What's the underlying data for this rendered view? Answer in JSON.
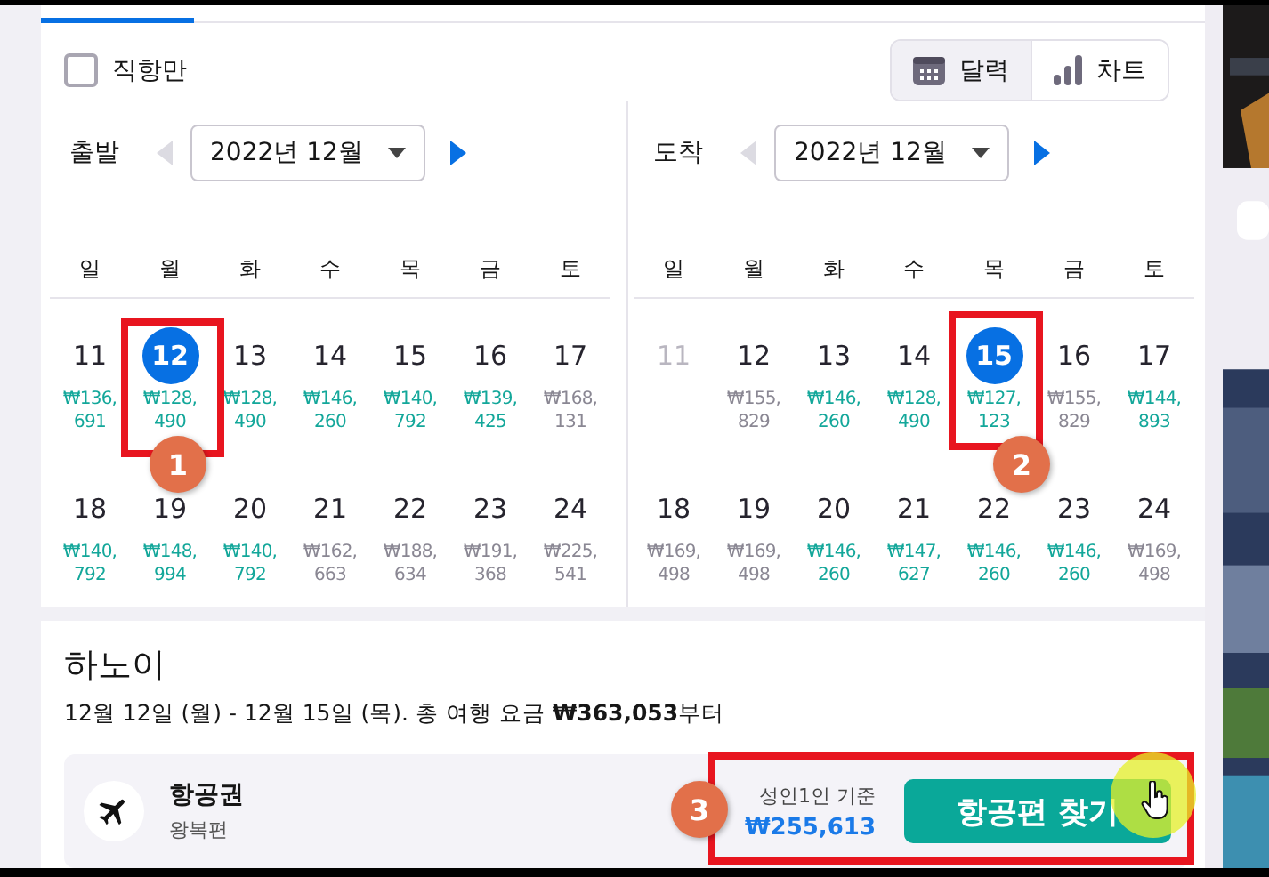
{
  "direct_only": {
    "label": "직항만",
    "checked": false
  },
  "view_toggle": [
    {
      "kind": "calendar",
      "label": "달력",
      "selected": true
    },
    {
      "kind": "chart",
      "label": "차트",
      "selected": false
    }
  ],
  "calendars": [
    {
      "label": "출발",
      "month": "2022년 12월",
      "prev_disabled": true,
      "weekdays": [
        "일",
        "월",
        "화",
        "수",
        "목",
        "금",
        "토"
      ],
      "weeks": [
        [
          {
            "day": "11",
            "price": "₩136,691",
            "cheap": true,
            "selected": false,
            "disabled": false
          },
          {
            "day": "12",
            "price": "₩128,490",
            "cheap": true,
            "selected": true,
            "disabled": false
          },
          {
            "day": "13",
            "price": "₩128,490",
            "cheap": true,
            "selected": false,
            "disabled": false
          },
          {
            "day": "14",
            "price": "₩146,260",
            "cheap": true,
            "selected": false,
            "disabled": false
          },
          {
            "day": "15",
            "price": "₩140,792",
            "cheap": true,
            "selected": false,
            "disabled": false
          },
          {
            "day": "16",
            "price": "₩139,425",
            "cheap": true,
            "selected": false,
            "disabled": false
          },
          {
            "day": "17",
            "price": "₩168,131",
            "cheap": false,
            "selected": false,
            "disabled": false
          }
        ],
        [
          {
            "day": "18",
            "price": "₩140,792",
            "cheap": true,
            "selected": false,
            "disabled": false
          },
          {
            "day": "19",
            "price": "₩148,994",
            "cheap": true,
            "selected": false,
            "disabled": false
          },
          {
            "day": "20",
            "price": "₩140,792",
            "cheap": true,
            "selected": false,
            "disabled": false
          },
          {
            "day": "21",
            "price": "₩162,663",
            "cheap": false,
            "selected": false,
            "disabled": false
          },
          {
            "day": "22",
            "price": "₩188,634",
            "cheap": false,
            "selected": false,
            "disabled": false
          },
          {
            "day": "23",
            "price": "₩191,368",
            "cheap": false,
            "selected": false,
            "disabled": false
          },
          {
            "day": "24",
            "price": "₩225,541",
            "cheap": false,
            "selected": false,
            "disabled": false
          }
        ]
      ]
    },
    {
      "label": "도착",
      "month": "2022년 12월",
      "prev_disabled": true,
      "weekdays": [
        "일",
        "월",
        "화",
        "수",
        "목",
        "금",
        "토"
      ],
      "weeks": [
        [
          {
            "day": "11",
            "selected": false,
            "disabled": true
          },
          {
            "day": "12",
            "price": "₩155,829",
            "cheap": false,
            "selected": false,
            "disabled": false
          },
          {
            "day": "13",
            "price": "₩146,260",
            "cheap": true,
            "selected": false,
            "disabled": false
          },
          {
            "day": "14",
            "price": "₩128,490",
            "cheap": true,
            "selected": false,
            "disabled": false
          },
          {
            "day": "15",
            "price": "₩127,123",
            "cheap": true,
            "selected": true,
            "disabled": false
          },
          {
            "day": "16",
            "price": "₩155,829",
            "cheap": false,
            "selected": false,
            "disabled": false
          },
          {
            "day": "17",
            "price": "₩144,893",
            "cheap": true,
            "selected": false,
            "disabled": false
          }
        ],
        [
          {
            "day": "18",
            "price": "₩169,498",
            "cheap": false,
            "selected": false,
            "disabled": false
          },
          {
            "day": "19",
            "price": "₩169,498",
            "cheap": false,
            "selected": false,
            "disabled": false
          },
          {
            "day": "20",
            "price": "₩146,260",
            "cheap": true,
            "selected": false,
            "disabled": false
          },
          {
            "day": "21",
            "price": "₩147,627",
            "cheap": true,
            "selected": false,
            "disabled": false
          },
          {
            "day": "22",
            "price": "₩146,260",
            "cheap": true,
            "selected": false,
            "disabled": false
          },
          {
            "day": "23",
            "price": "₩146,260",
            "cheap": true,
            "selected": false,
            "disabled": false
          },
          {
            "day": "24",
            "price": "₩169,498",
            "cheap": false,
            "selected": false,
            "disabled": false
          }
        ]
      ]
    }
  ],
  "trip": {
    "city": "하노이",
    "summary": "12월 12일 (월) - 12월 15일 (목).  총 여행 요금 **₩363,053**부터",
    "flight": {
      "title": "항공권",
      "subtitle": "왕복편",
      "price_note": "성인1인 기준",
      "price": "₩255,613",
      "button": "항공편 찾기"
    }
  },
  "annotations": [
    {
      "number": "1"
    },
    {
      "number": "2"
    },
    {
      "number": "3"
    }
  ]
}
